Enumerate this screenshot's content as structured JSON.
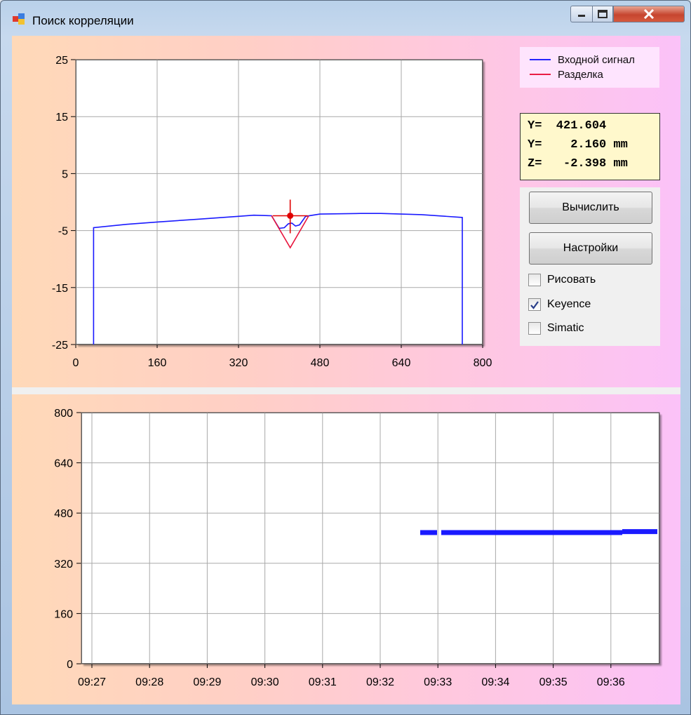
{
  "window": {
    "title": "Поиск корреляции",
    "buttons": {
      "minimize": "minimize",
      "maximize": "maximize",
      "close": "close"
    }
  },
  "legend": {
    "items": [
      {
        "label": "Входной сигнал",
        "color": "#1a1aff"
      },
      {
        "label": "Разделка",
        "color": "#e8143c"
      }
    ]
  },
  "readout": {
    "rows": [
      "Y=  421.604",
      "Y=    2.160 mm",
      "Z=   -2.398 mm"
    ]
  },
  "controls": {
    "calc_label": "Вычислить",
    "settings_label": "Настройки",
    "checkboxes": [
      {
        "label": "Рисовать",
        "checked": false
      },
      {
        "label": "Keyence",
        "checked": true
      },
      {
        "label": "Simatic",
        "checked": false
      }
    ]
  },
  "colors": {
    "signal": "#1a1aff",
    "cut": "#e8143c",
    "marker": "#e00000"
  },
  "chart_data": [
    {
      "type": "line",
      "xlim": [
        0,
        800
      ],
      "ylim": [
        -25,
        25
      ],
      "x_ticks": [
        "0",
        "160",
        "320",
        "480",
        "640",
        "800"
      ],
      "y_ticks": [
        "25",
        "15",
        "5",
        "-5",
        "-15",
        "-25"
      ],
      "grid": true,
      "legend": "top-right",
      "series": [
        {
          "name": "Входной сигнал",
          "color": "#1a1aff",
          "points": [
            [
              35,
              -25
            ],
            [
              35,
              -4.5
            ],
            [
              100,
              -3.9
            ],
            [
              160,
              -3.5
            ],
            [
              240,
              -3.0
            ],
            [
              320,
              -2.5
            ],
            [
              350,
              -2.3
            ],
            [
              385,
              -2.4
            ],
            [
              400,
              -4.6
            ],
            [
              410,
              -4.5
            ],
            [
              418,
              -3.8
            ],
            [
              425,
              -3.7
            ],
            [
              432,
              -4.2
            ],
            [
              440,
              -4.0
            ],
            [
              452,
              -2.5
            ],
            [
              480,
              -2.1
            ],
            [
              560,
              -2.0
            ],
            [
              600,
              -2.0
            ],
            [
              680,
              -2.2
            ],
            [
              760,
              -2.7
            ],
            [
              760,
              -25
            ]
          ]
        },
        {
          "name": "Разделка",
          "color": "#e8143c",
          "points": [
            [
              385,
              -2.4
            ],
            [
              421.6,
              -8.0
            ],
            [
              458,
              -2.4
            ]
          ]
        }
      ],
      "marker": {
        "x": 421.604,
        "y": -2.4
      }
    },
    {
      "type": "scatter",
      "ylim": [
        0,
        800
      ],
      "y_ticks": [
        "800",
        "640",
        "480",
        "320",
        "160",
        "0"
      ],
      "x_ticks": [
        "09:27",
        "09:28",
        "09:29",
        "09:30",
        "09:31",
        "09:32",
        "09:33",
        "09:34",
        "09:35",
        "09:36"
      ],
      "grid": true,
      "series": [
        {
          "color": "#1a1aff",
          "segments": [
            {
              "from": 582,
              "to": 606,
              "value": 418
            },
            {
              "from": 612,
              "to": 870,
              "value": 418
            },
            {
              "from": 870,
              "to": 920,
              "value": 421
            }
          ]
        }
      ]
    }
  ]
}
